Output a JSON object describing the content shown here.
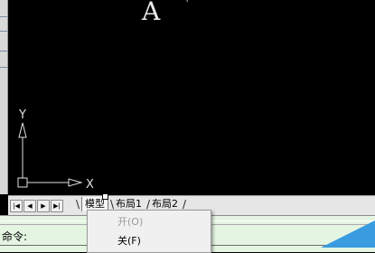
{
  "canvas": {
    "letter": "A",
    "stray_mark": "’"
  },
  "ucs": {
    "x_label": "X",
    "y_label": "Y"
  },
  "layout_tabs": {
    "nav_buttons": [
      "|◀",
      "◀",
      "▶",
      "▶|"
    ],
    "tabs": [
      "模型",
      "布局1",
      "布局2"
    ]
  },
  "command_line": {
    "prompt": "命令:"
  },
  "context_menu": {
    "items": [
      {
        "label": "开(O)",
        "enabled": false
      },
      {
        "label": "关(F)",
        "enabled": true
      }
    ]
  },
  "colors": {
    "canvas_bg": "#000000",
    "command_bg": "#e4f5e2",
    "accent": "#3a9be0"
  }
}
